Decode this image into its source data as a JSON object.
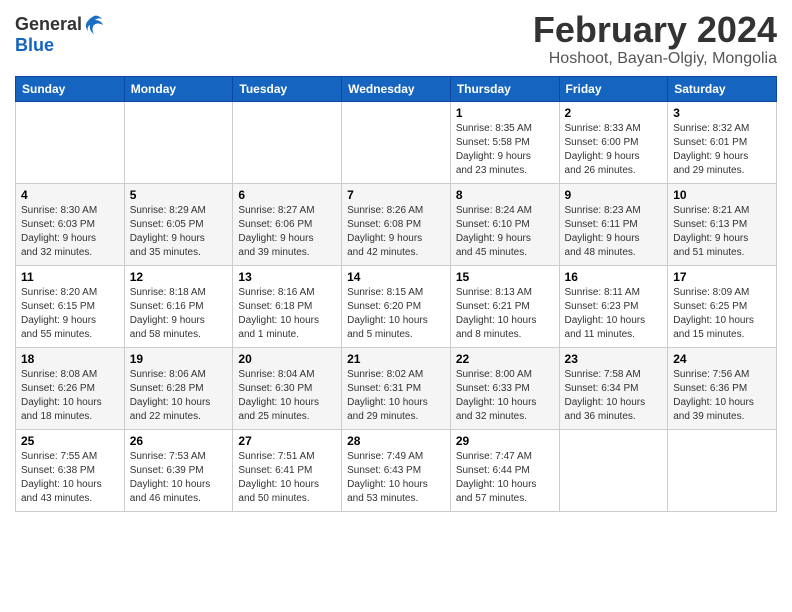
{
  "logo": {
    "general": "General",
    "blue": "Blue"
  },
  "header": {
    "month": "February 2024",
    "location": "Hoshoot, Bayan-Olgiy, Mongolia"
  },
  "weekdays": [
    "Sunday",
    "Monday",
    "Tuesday",
    "Wednesday",
    "Thursday",
    "Friday",
    "Saturday"
  ],
  "weeks": [
    [
      {
        "day": "",
        "info": ""
      },
      {
        "day": "",
        "info": ""
      },
      {
        "day": "",
        "info": ""
      },
      {
        "day": "",
        "info": ""
      },
      {
        "day": "1",
        "info": "Sunrise: 8:35 AM\nSunset: 5:58 PM\nDaylight: 9 hours\nand 23 minutes."
      },
      {
        "day": "2",
        "info": "Sunrise: 8:33 AM\nSunset: 6:00 PM\nDaylight: 9 hours\nand 26 minutes."
      },
      {
        "day": "3",
        "info": "Sunrise: 8:32 AM\nSunset: 6:01 PM\nDaylight: 9 hours\nand 29 minutes."
      }
    ],
    [
      {
        "day": "4",
        "info": "Sunrise: 8:30 AM\nSunset: 6:03 PM\nDaylight: 9 hours\nand 32 minutes."
      },
      {
        "day": "5",
        "info": "Sunrise: 8:29 AM\nSunset: 6:05 PM\nDaylight: 9 hours\nand 35 minutes."
      },
      {
        "day": "6",
        "info": "Sunrise: 8:27 AM\nSunset: 6:06 PM\nDaylight: 9 hours\nand 39 minutes."
      },
      {
        "day": "7",
        "info": "Sunrise: 8:26 AM\nSunset: 6:08 PM\nDaylight: 9 hours\nand 42 minutes."
      },
      {
        "day": "8",
        "info": "Sunrise: 8:24 AM\nSunset: 6:10 PM\nDaylight: 9 hours\nand 45 minutes."
      },
      {
        "day": "9",
        "info": "Sunrise: 8:23 AM\nSunset: 6:11 PM\nDaylight: 9 hours\nand 48 minutes."
      },
      {
        "day": "10",
        "info": "Sunrise: 8:21 AM\nSunset: 6:13 PM\nDaylight: 9 hours\nand 51 minutes."
      }
    ],
    [
      {
        "day": "11",
        "info": "Sunrise: 8:20 AM\nSunset: 6:15 PM\nDaylight: 9 hours\nand 55 minutes."
      },
      {
        "day": "12",
        "info": "Sunrise: 8:18 AM\nSunset: 6:16 PM\nDaylight: 9 hours\nand 58 minutes."
      },
      {
        "day": "13",
        "info": "Sunrise: 8:16 AM\nSunset: 6:18 PM\nDaylight: 10 hours\nand 1 minute."
      },
      {
        "day": "14",
        "info": "Sunrise: 8:15 AM\nSunset: 6:20 PM\nDaylight: 10 hours\nand 5 minutes."
      },
      {
        "day": "15",
        "info": "Sunrise: 8:13 AM\nSunset: 6:21 PM\nDaylight: 10 hours\nand 8 minutes."
      },
      {
        "day": "16",
        "info": "Sunrise: 8:11 AM\nSunset: 6:23 PM\nDaylight: 10 hours\nand 11 minutes."
      },
      {
        "day": "17",
        "info": "Sunrise: 8:09 AM\nSunset: 6:25 PM\nDaylight: 10 hours\nand 15 minutes."
      }
    ],
    [
      {
        "day": "18",
        "info": "Sunrise: 8:08 AM\nSunset: 6:26 PM\nDaylight: 10 hours\nand 18 minutes."
      },
      {
        "day": "19",
        "info": "Sunrise: 8:06 AM\nSunset: 6:28 PM\nDaylight: 10 hours\nand 22 minutes."
      },
      {
        "day": "20",
        "info": "Sunrise: 8:04 AM\nSunset: 6:30 PM\nDaylight: 10 hours\nand 25 minutes."
      },
      {
        "day": "21",
        "info": "Sunrise: 8:02 AM\nSunset: 6:31 PM\nDaylight: 10 hours\nand 29 minutes."
      },
      {
        "day": "22",
        "info": "Sunrise: 8:00 AM\nSunset: 6:33 PM\nDaylight: 10 hours\nand 32 minutes."
      },
      {
        "day": "23",
        "info": "Sunrise: 7:58 AM\nSunset: 6:34 PM\nDaylight: 10 hours\nand 36 minutes."
      },
      {
        "day": "24",
        "info": "Sunrise: 7:56 AM\nSunset: 6:36 PM\nDaylight: 10 hours\nand 39 minutes."
      }
    ],
    [
      {
        "day": "25",
        "info": "Sunrise: 7:55 AM\nSunset: 6:38 PM\nDaylight: 10 hours\nand 43 minutes."
      },
      {
        "day": "26",
        "info": "Sunrise: 7:53 AM\nSunset: 6:39 PM\nDaylight: 10 hours\nand 46 minutes."
      },
      {
        "day": "27",
        "info": "Sunrise: 7:51 AM\nSunset: 6:41 PM\nDaylight: 10 hours\nand 50 minutes."
      },
      {
        "day": "28",
        "info": "Sunrise: 7:49 AM\nSunset: 6:43 PM\nDaylight: 10 hours\nand 53 minutes."
      },
      {
        "day": "29",
        "info": "Sunrise: 7:47 AM\nSunset: 6:44 PM\nDaylight: 10 hours\nand 57 minutes."
      },
      {
        "day": "",
        "info": ""
      },
      {
        "day": "",
        "info": ""
      }
    ]
  ]
}
